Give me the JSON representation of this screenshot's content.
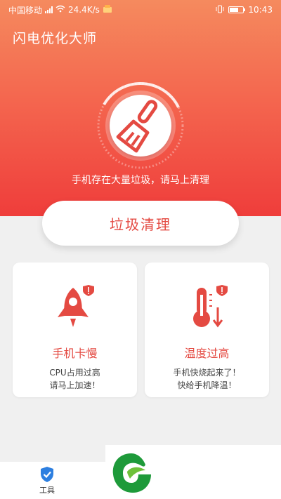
{
  "status_bar": {
    "carrier": "中国移动",
    "speed": "24.4K/s",
    "time": "10:43"
  },
  "app": {
    "title": "闪电优化大师"
  },
  "hero": {
    "message": "手机存在大量垃圾，请马上清理"
  },
  "main_button": {
    "label": "垃圾清理"
  },
  "cards": [
    {
      "title": "手机卡慢",
      "desc_line1": "CPU占用过高",
      "desc_line2": "请马上加速！",
      "icon": "rocket-icon"
    },
    {
      "title": "温度过高",
      "desc_line1": "手机快烧起来了！",
      "desc_line2": "快给手机降温！",
      "icon": "thermometer-icon"
    }
  ],
  "tabbar": {
    "tools_label": "工具",
    "tools_icon": "shield-check-icon"
  },
  "colors": {
    "accent": "#e44a42",
    "hero_top": "#f58a5e",
    "hero_bottom": "#ef3d3b",
    "tab_blue": "#2d7fe0",
    "watermark_green": "#1e9a3a"
  }
}
